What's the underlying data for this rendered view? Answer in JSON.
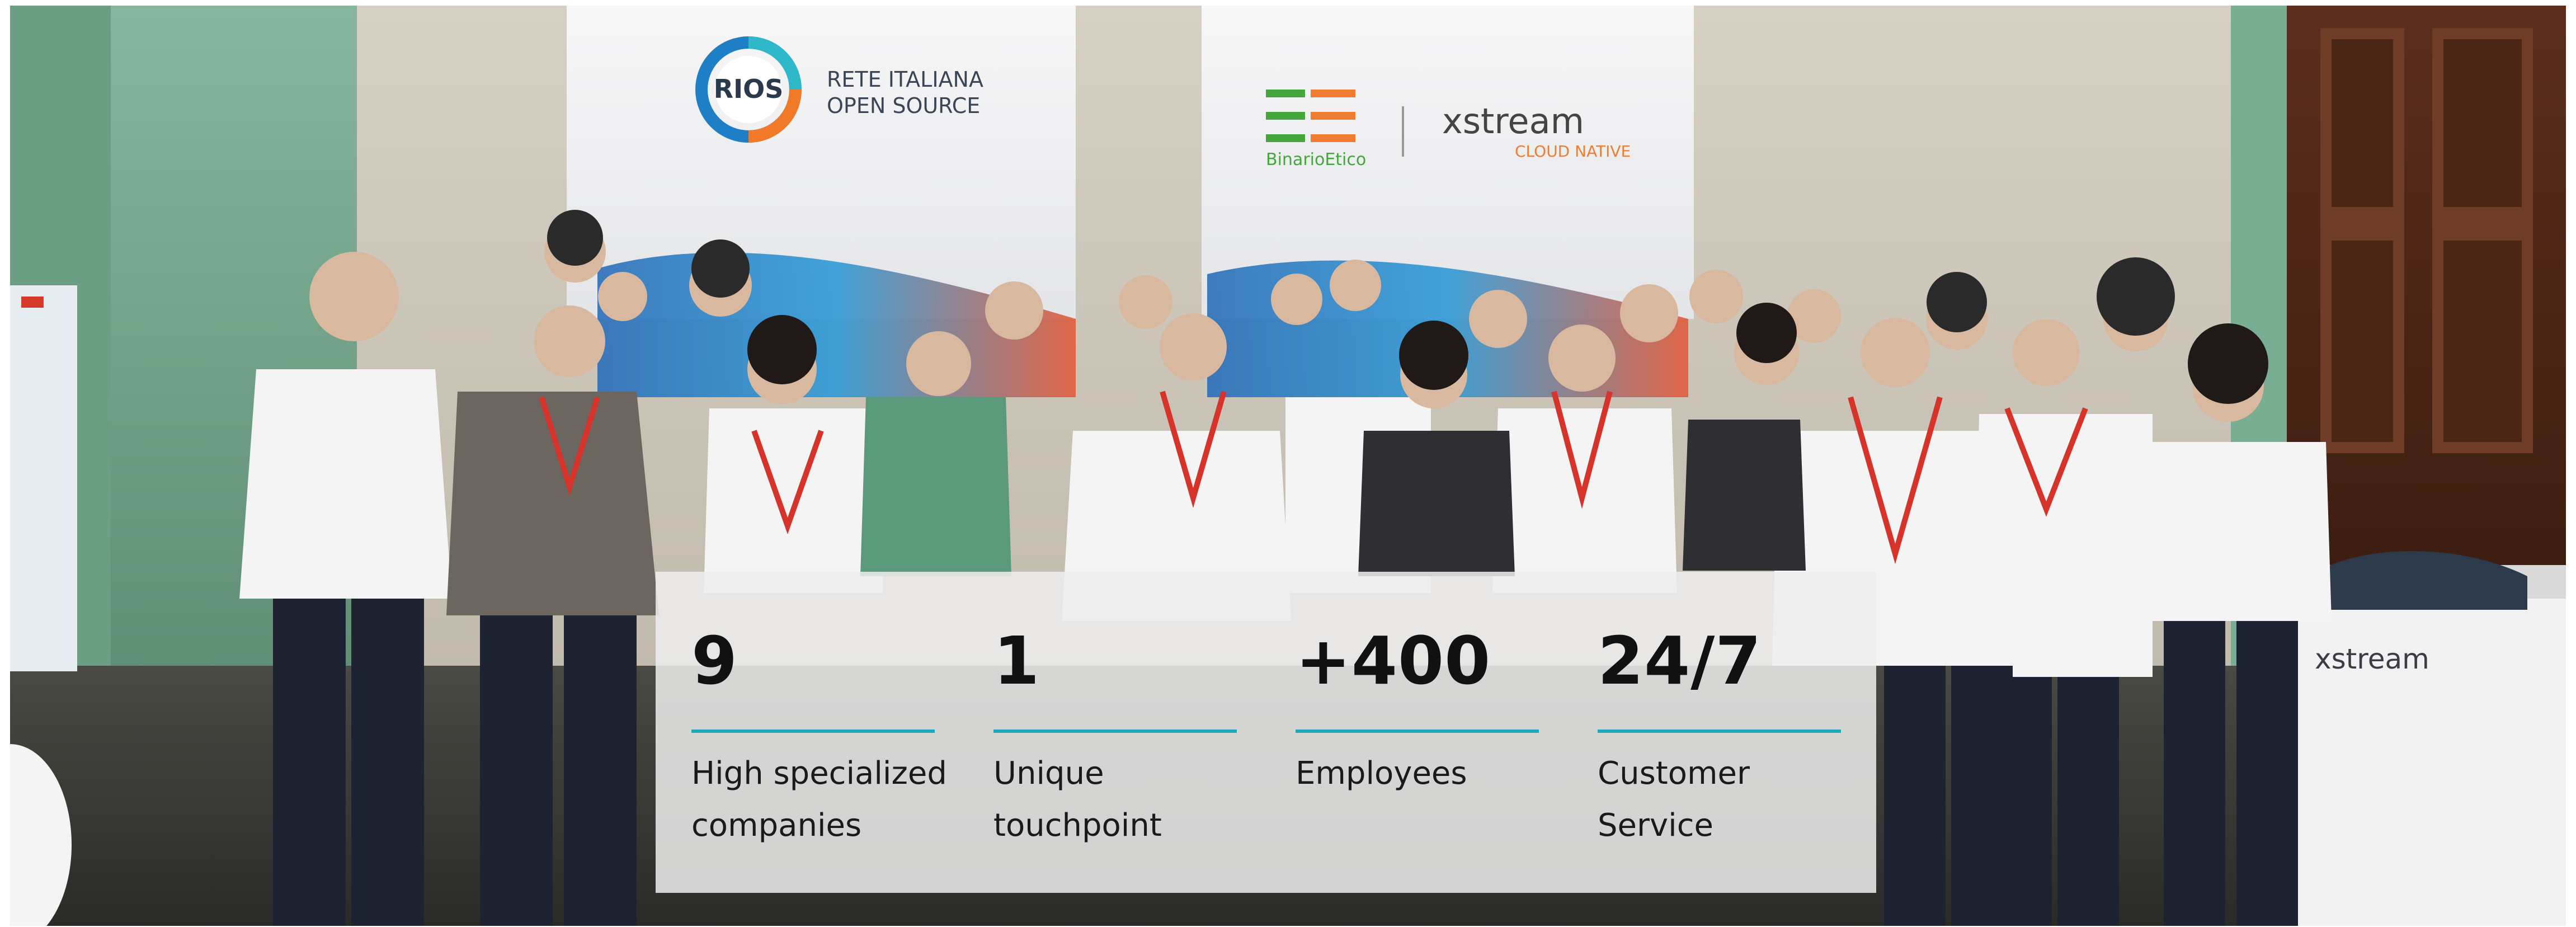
{
  "backdrop": {
    "left_banner": {
      "logo_text": "RIOS",
      "tagline_line1": "RETE ITALIANA",
      "tagline_line2": "OPEN SOURCE"
    },
    "right_banner": {
      "brand_one": "BinarioEtico",
      "brand_two": "xstream",
      "brand_two_sub": "CLOUD NATIVE"
    },
    "booth_counter_text": "xstream"
  },
  "stats": [
    {
      "value": "9",
      "label_line1": "High specialized",
      "label_line2": "companies"
    },
    {
      "value": "1",
      "label_line1": "Unique",
      "label_line2": "touchpoint"
    },
    {
      "value": "+400",
      "label_line1": "Employees",
      "label_line2": ""
    },
    {
      "value": "24/7",
      "label_line1": "Customer",
      "label_line2": "Service"
    }
  ],
  "colors": {
    "accent_rule": "#1fa9b8",
    "panel_bg": "#eeeeee",
    "text": "#111111",
    "rios_blue": "#1e7fc6",
    "rios_orange": "#f07a28",
    "binario_green": "#46a63e",
    "binario_orange": "#ee7d31",
    "xstream_gray": "#444444"
  }
}
